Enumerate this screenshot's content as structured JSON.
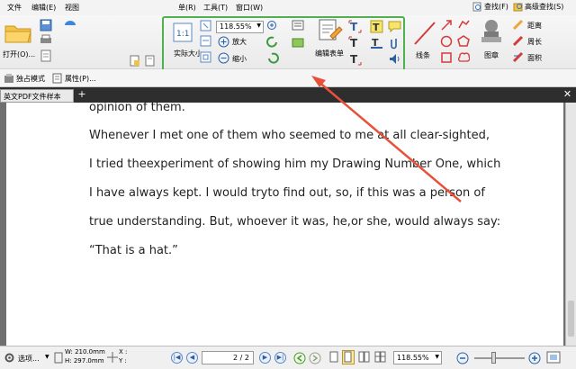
{
  "menubar": {
    "items": [
      "文件",
      "编辑(E)",
      "视图",
      "单(R)",
      "工具(T)",
      "窗口(W)"
    ],
    "find_label": "查找(F)",
    "advanced_find_label": "高级查找(S)"
  },
  "toolbar": {
    "open_label": "打开(O)...",
    "zoom_value": "118.55%",
    "enlarge_label": "放大",
    "shrink_label": "缩小",
    "actual_size_label": "实际大小",
    "edit_form_label": "编辑表单",
    "line_label": "线条",
    "stamp_label": "图章",
    "distance_label": "距离",
    "perimeter_label": "周长",
    "area_label": "面积",
    "exclusive_mode_label": "独占模式",
    "properties_label": "属性(P)..."
  },
  "tabs": [
    {
      "label": "英文PDF文件样本"
    }
  ],
  "document": {
    "lines": [
      "opinion of them.",
      "Whenever I met one of them who seemed to me at all clear-sighted,",
      "I tried theexperiment of showing him my Drawing Number One, which",
      "I have always kept. I would tryto find out, so,     if this was a person of",
      "true understanding. But, whoever it was,     he,or she, would always say:",
      "“That is a hat.”"
    ]
  },
  "statusbar": {
    "options_label": "选项...",
    "width_label": "W: 210.0mm",
    "height_label": "H: 297.0mm",
    "x_label": "X :",
    "y_label": "Y :",
    "page_value": "2 / 2",
    "zoom_value": "118.55%"
  },
  "colors": {
    "highlight_frame": "#4fb04f",
    "arrow": "#e8503a",
    "nav_button": "#5a87c5"
  }
}
